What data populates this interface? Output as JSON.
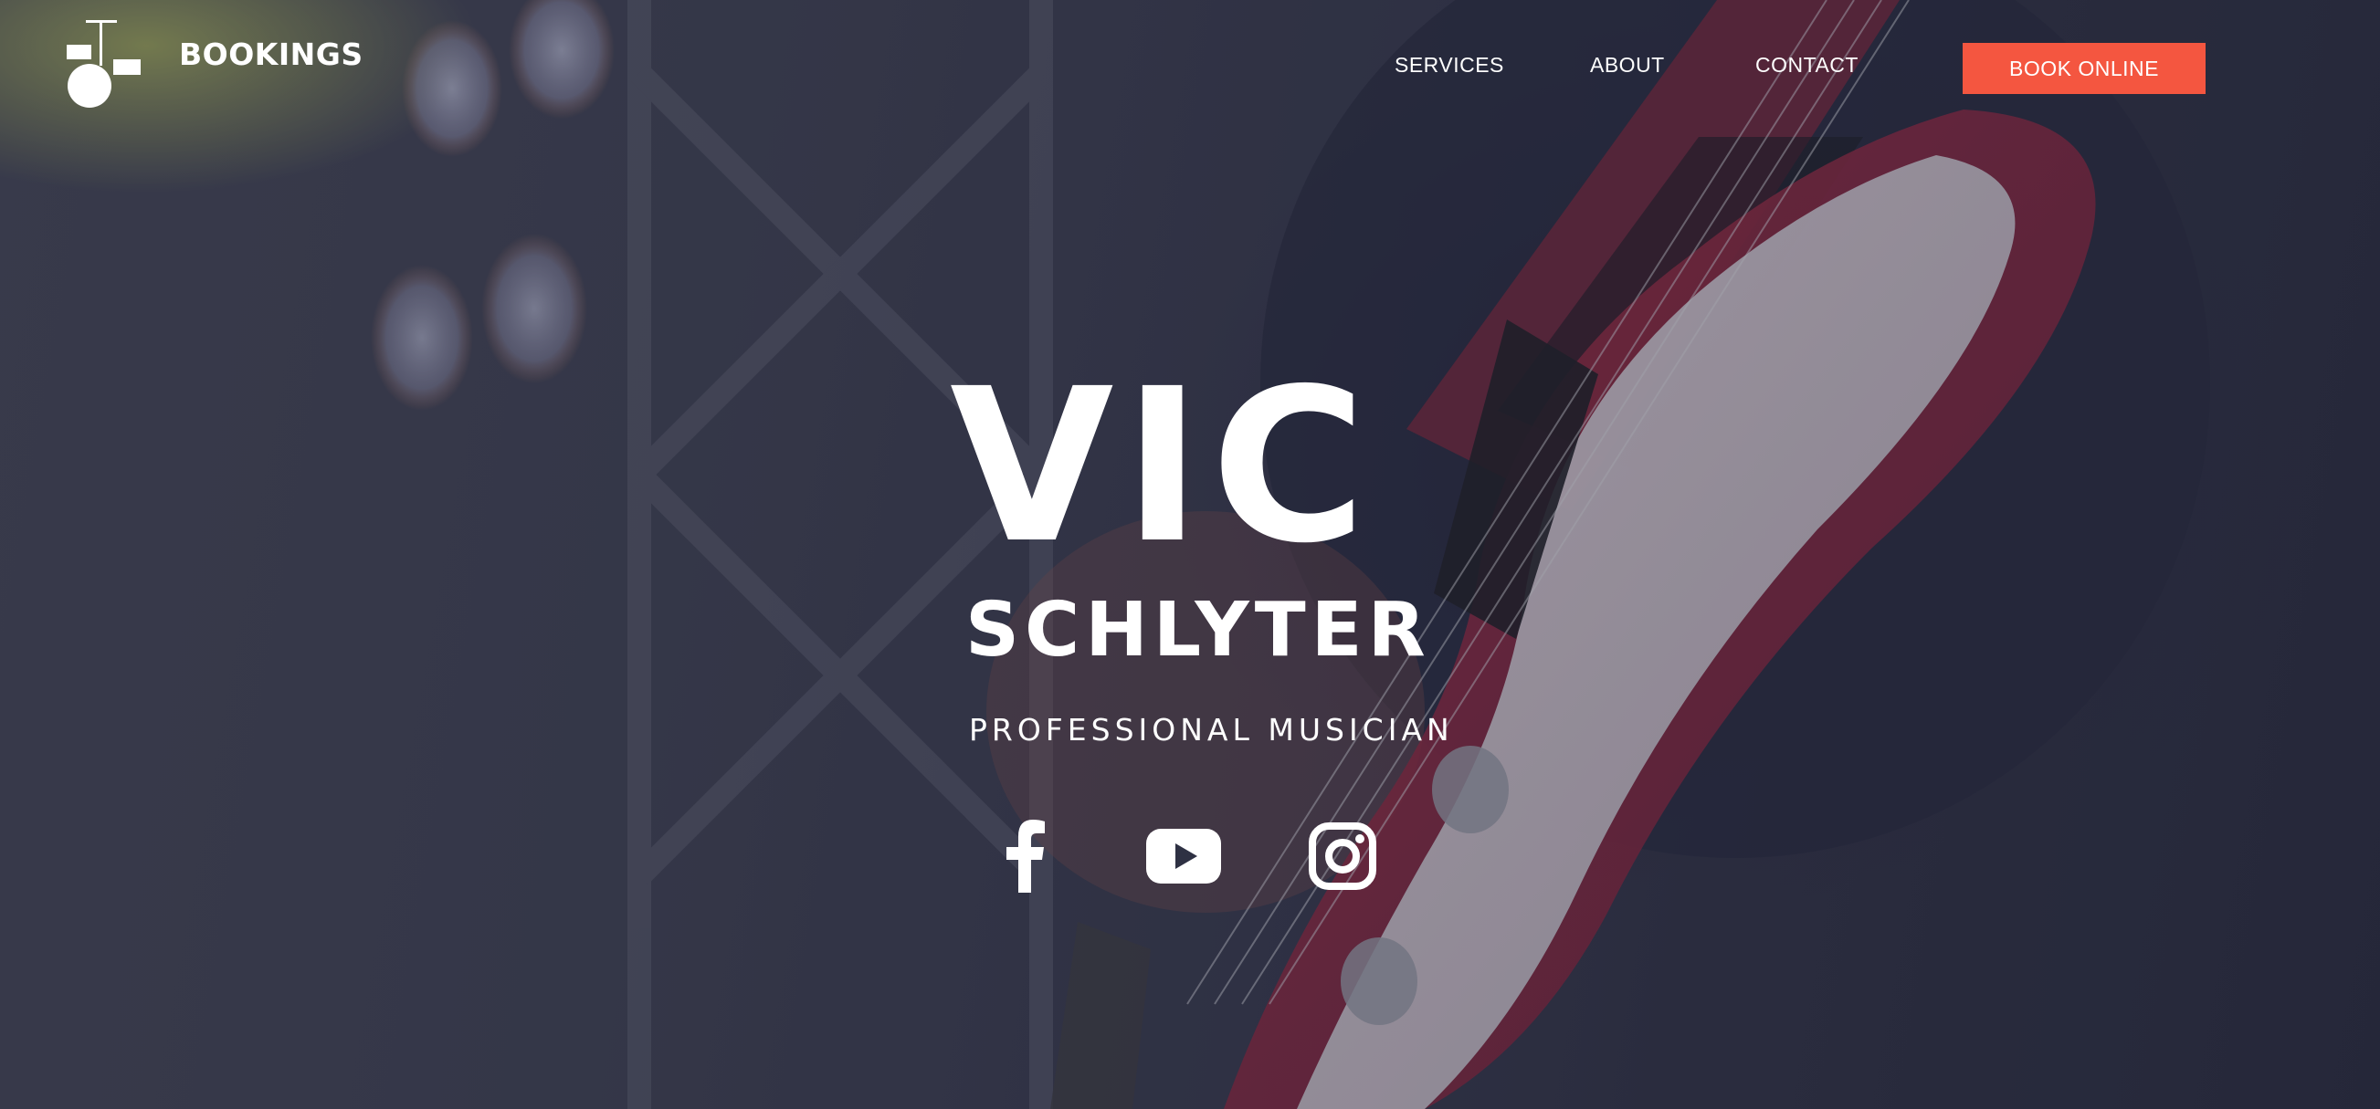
{
  "header": {
    "brand": "BOOKINGS",
    "logo_icon": "drum-kit-icon"
  },
  "nav": {
    "items": [
      {
        "label": "SERVICES"
      },
      {
        "label": "ABOUT"
      },
      {
        "label": "CONTACT"
      }
    ],
    "cta_label": "BOOK ONLINE"
  },
  "hero": {
    "first_name": "VIC",
    "last_name": "SCHLYTER",
    "tagline": "PROFESSIONAL MUSICIAN"
  },
  "social": [
    {
      "icon": "facebook-icon"
    },
    {
      "icon": "youtube-icon"
    },
    {
      "icon": "instagram-icon"
    }
  ],
  "colors": {
    "accent": "#f45640",
    "text": "#ffffff",
    "background": "#2e3143"
  }
}
